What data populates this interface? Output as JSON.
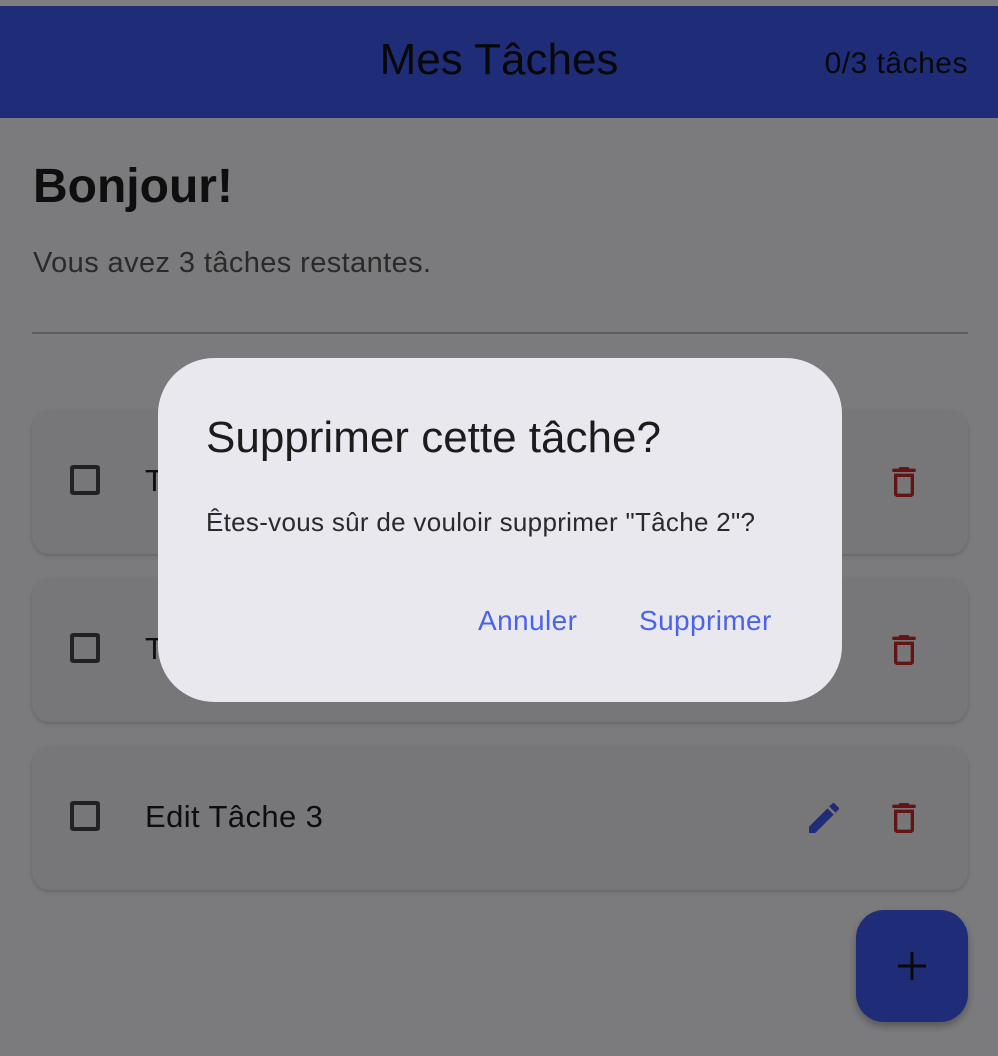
{
  "app_bar": {
    "title": "Mes Tâches",
    "counter": "0/3 tâches"
  },
  "header": {
    "greeting": "Bonjour!",
    "remaining": "Vous avez 3 tâches restantes."
  },
  "tasks": [
    {
      "label": "T",
      "checked": false
    },
    {
      "label": "T",
      "checked": false
    },
    {
      "label": "Edit Tâche 3",
      "checked": false
    }
  ],
  "fab": {
    "icon": "add-icon"
  },
  "dialog": {
    "title": "Supprimer cette tâche?",
    "message": "Êtes-vous sûr de vouloir supprimer \"Tâche 2\"?",
    "cancel_label": "Annuler",
    "confirm_label": "Supprimer"
  },
  "colors": {
    "primary": "#3f5af0",
    "delete": "#c62828",
    "edit": "#3f5af0",
    "dialog_button": "#4a63e8"
  }
}
